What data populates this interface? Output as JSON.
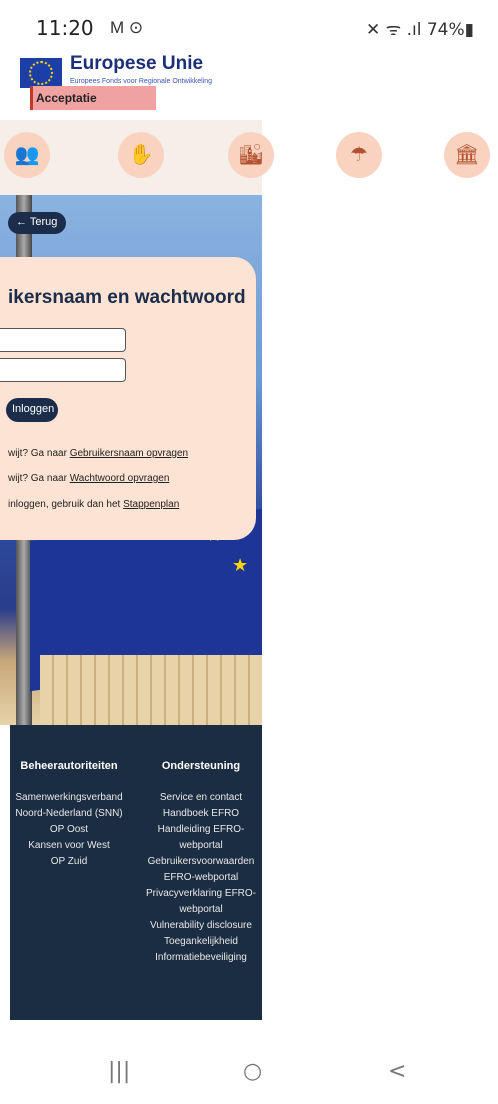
{
  "status": {
    "time": "11:20",
    "left_icons": "M ⊙",
    "right": "✕ ᯤ .ıl 74%▮"
  },
  "header": {
    "title": "Europese Unie",
    "subtitle": "Europees Fonds voor Regionale Ontwikkeling",
    "env_badge": "Acceptatie"
  },
  "icons": [
    "people-icon",
    "hands-icon",
    "city-icon",
    "umbrella-icon",
    "building-icon"
  ],
  "back_label": "← Terug",
  "login": {
    "title": "ikersnaam en wachtwoord",
    "button": "Inloggen",
    "line1_text": "wijt? Ga naar ",
    "line1_link": "Gebruikersnaam opvragen",
    "line2_text": "wijt? Ga naar ",
    "line2_link": "Wachtwoord opvragen",
    "line3_text": " inloggen, gebruik dan het ",
    "line3_link": "Stappenplan"
  },
  "footer": {
    "col1": {
      "heading": "Beheerautoriteiten",
      "items": [
        "Samenwerkingsverband",
        "Noord-Nederland (SNN)",
        "OP Oost",
        "Kansen voor West",
        "OP Zuid"
      ]
    },
    "col2": {
      "heading": "Ondersteuning",
      "items": [
        "Service en contact",
        "Handboek EFRO",
        "Handleiding EFRO-",
        "webportal",
        "Gebruikersvoorwaarden",
        "EFRO-webportal",
        "Privacyverklaring EFRO-",
        "webportal",
        "Vulnerability disclosure",
        "Toegankelijkheid",
        "Informatiebeveiliging"
      ]
    }
  },
  "nav": {
    "recent": "|||",
    "home": "○",
    "back": "<"
  }
}
